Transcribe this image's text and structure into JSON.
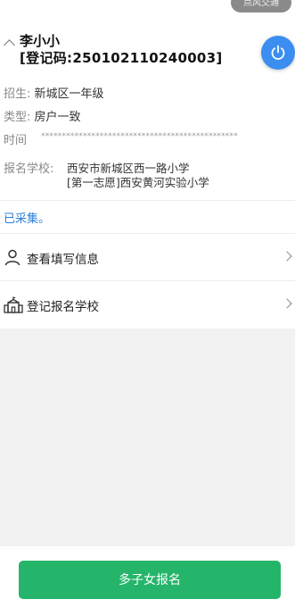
{
  "header": {
    "corner_pill_text": "点风交通",
    "student_name": "李小小",
    "reg_code": "[登记码:250102110240003]"
  },
  "details": {
    "enroll_label": "招生:",
    "enroll_value": "新城区一年级",
    "type_label": "类型:",
    "type_value": "房户一致",
    "time_label": "时间",
    "time_value": "***********************************************",
    "school_label": "报名学校:",
    "school_line_1": "西安市新城区西一路小学",
    "school_line_2": "[第一志愿]西安黄河实验小学"
  },
  "status": {
    "collected_text": "已采集。"
  },
  "menu": [
    {
      "label": "查看填写信息",
      "icon": "user-icon"
    },
    {
      "label": "登记报名学校",
      "icon": "school-icon"
    }
  ],
  "footer": {
    "primary_button": "多子女报名"
  },
  "colors": {
    "accent_green": "#25b56a",
    "link_blue": "#2a7fd6",
    "power_blue": "#3b8ef0"
  }
}
